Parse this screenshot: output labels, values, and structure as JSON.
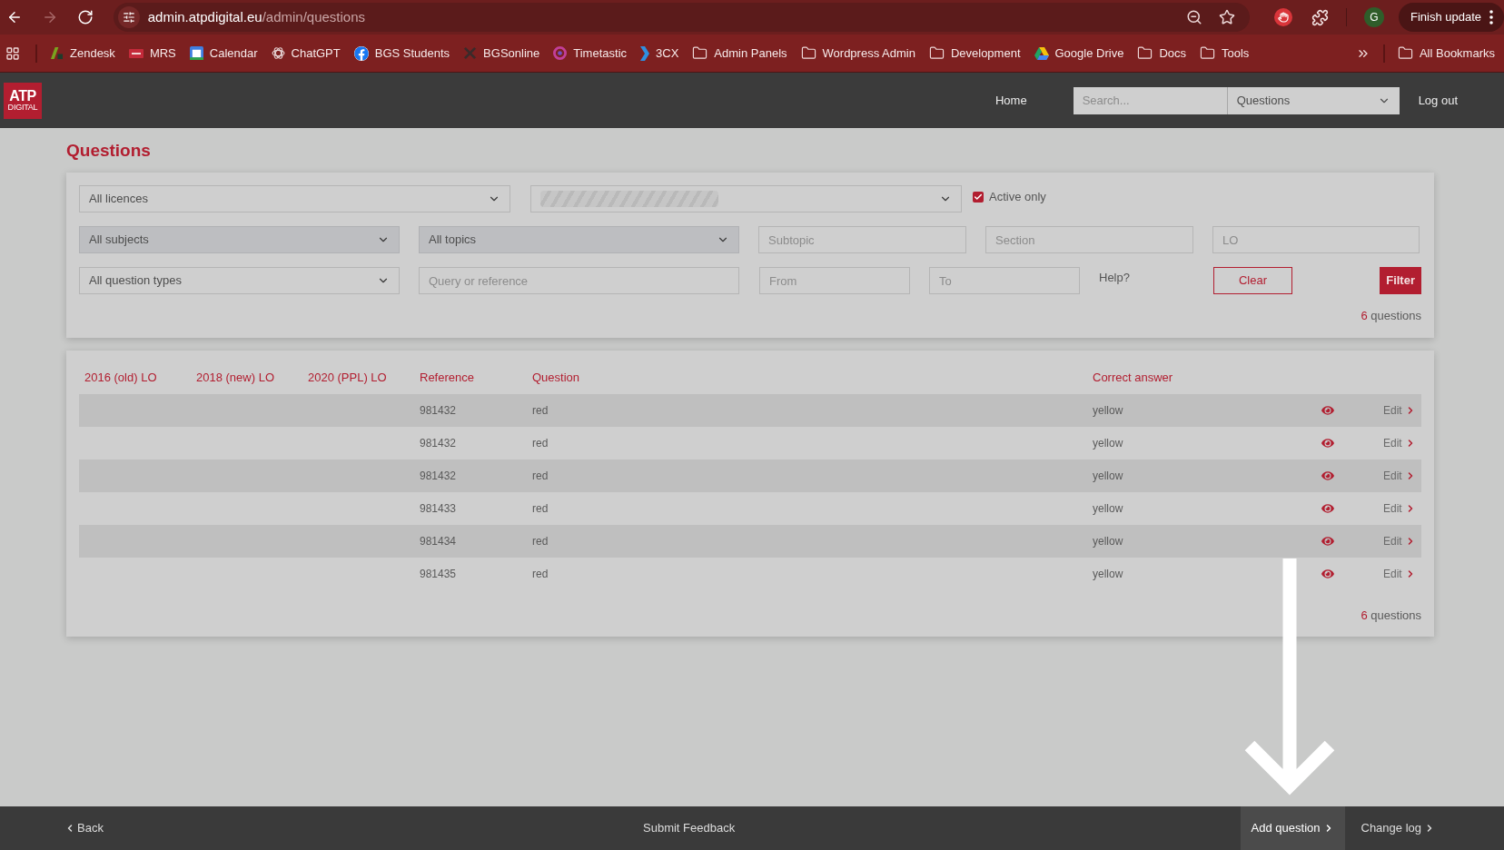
{
  "browser": {
    "nav_buttons": [
      {
        "kind": "back",
        "disabled": false
      },
      {
        "kind": "forward",
        "disabled": true
      },
      {
        "kind": "reload",
        "disabled": false
      }
    ],
    "address_bar": {
      "host": "admin.atpdigital.eu",
      "path": "/admin/questions"
    },
    "profile_initial": "G",
    "update_button": "Finish update"
  },
  "bookmarks_bar": {
    "items": [
      {
        "kind": "shapes",
        "label": "Zendesk"
      },
      {
        "kind": "badge",
        "label": "MRS"
      },
      {
        "kind": "calendar",
        "label": "Calendar"
      },
      {
        "kind": "knot",
        "label": "ChatGPT"
      },
      {
        "kind": "circle-f",
        "label": "BGS Students"
      },
      {
        "kind": "cross",
        "label": "BGSonline"
      },
      {
        "kind": "spiral",
        "label": "Timetastic"
      },
      {
        "kind": "chevron",
        "label": "3CX"
      },
      {
        "kind": "folder",
        "label": "Admin Panels"
      },
      {
        "kind": "folder",
        "label": "Wordpress Admin"
      },
      {
        "kind": "folder",
        "label": "Development"
      },
      {
        "kind": "triangle",
        "label": "Google Drive"
      },
      {
        "kind": "folder",
        "label": "Docs"
      },
      {
        "kind": "folder",
        "label": "Tools"
      }
    ],
    "all_bookmarks": "All Bookmarks"
  },
  "app_header": {
    "logo": {
      "text": "ATP",
      "subtext": "DIGITAL"
    },
    "nav_link": "Home",
    "search": {
      "placeholder": "Search..."
    },
    "section_select": {
      "value": "Questions"
    },
    "logout": "Log out"
  },
  "page_title": "Questions",
  "filters": {
    "licence": {
      "value": "All licences",
      "disabled": false
    },
    "second_select": {
      "redacted": true,
      "disabled": false
    },
    "active_only": {
      "label": "Active only",
      "checked": true
    },
    "subject": {
      "value": "All subjects",
      "disabled": true
    },
    "topic": {
      "value": "All topics",
      "disabled": true
    },
    "subtopic": {
      "placeholder": "Subtopic"
    },
    "section": {
      "placeholder": "Section"
    },
    "lo": {
      "placeholder": "LO"
    },
    "question_type": {
      "value": "All question types",
      "disabled": false
    },
    "query": {
      "placeholder": "Query or reference"
    },
    "from": {
      "placeholder": "From"
    },
    "to": {
      "placeholder": "To"
    },
    "help": "Help?",
    "clear_button": "Clear",
    "filter_button": "Filter",
    "result_count": {
      "count": "6",
      "label": "questions"
    }
  },
  "table": {
    "columns": [
      "2016 (old) LO",
      "2018 (new) LO",
      "2020 (PPL) LO",
      "Reference",
      "Question",
      "Correct answer"
    ],
    "rows": [
      {
        "reference": "981432",
        "question": "red",
        "correct_answer": "yellow",
        "edit": "Edit"
      },
      {
        "reference": "981432",
        "question": "red",
        "correct_answer": "yellow",
        "edit": "Edit"
      },
      {
        "reference": "981432",
        "question": "red",
        "correct_answer": "yellow",
        "edit": "Edit"
      },
      {
        "reference": "981433",
        "question": "red",
        "correct_answer": "yellow",
        "edit": "Edit"
      },
      {
        "reference": "981434",
        "question": "red",
        "correct_answer": "yellow",
        "edit": "Edit"
      },
      {
        "reference": "981435",
        "question": "red",
        "correct_answer": "yellow",
        "edit": "Edit"
      }
    ],
    "result_count": {
      "count": "6",
      "label": "questions"
    }
  },
  "footer": {
    "back": "Back",
    "feedback": "Submit Feedback",
    "links": [
      {
        "label": "Add question",
        "highlighted": true
      },
      {
        "label": "Change log",
        "highlighted": false
      }
    ]
  }
}
